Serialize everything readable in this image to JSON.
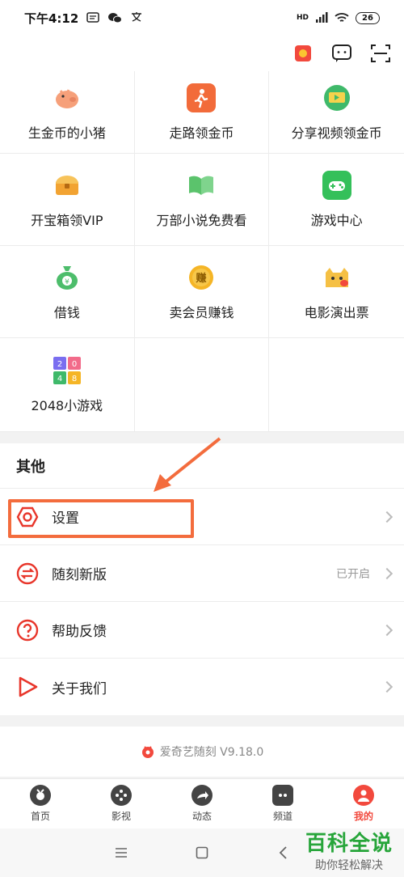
{
  "status_bar": {
    "time": "下午4:12",
    "battery": "26",
    "signal": "HD"
  },
  "grid_items": [
    {
      "label": "生金币的小猪",
      "icon": "pig-icon",
      "color": "#f6a07a"
    },
    {
      "label": "走路领金币",
      "icon": "walking-icon",
      "color": "#f26b3a"
    },
    {
      "label": "分享视频领金币",
      "icon": "share-video-icon",
      "color": "#3fb96a"
    },
    {
      "label": "开宝箱领VIP",
      "icon": "treasure-chest-icon",
      "color": "#f2a332"
    },
    {
      "label": "万部小说免费看",
      "icon": "book-icon",
      "color": "#5bc36c"
    },
    {
      "label": "游戏中心",
      "icon": "game-controller-icon",
      "color": "#34c05a"
    },
    {
      "label": "借钱",
      "icon": "money-bag-icon",
      "color": "#4dbd6b"
    },
    {
      "label": "卖会员赚钱",
      "icon": "earn-coin-icon",
      "color": "#f5b526"
    },
    {
      "label": "电影演出票",
      "icon": "cat-ticket-icon",
      "color": "#f5c044"
    },
    {
      "label": "2048小游戏",
      "icon": "game-2048-icon",
      "color": "#7a6ef0"
    }
  ],
  "other_section": {
    "title": "其他",
    "rows": [
      {
        "label": "设置",
        "icon": "settings-icon",
        "status": ""
      },
      {
        "label": "随刻新版",
        "icon": "switch-icon",
        "status": "已开启"
      },
      {
        "label": "帮助反馈",
        "icon": "help-icon",
        "status": ""
      },
      {
        "label": "关于我们",
        "icon": "play-icon",
        "status": ""
      }
    ]
  },
  "version_text": "爱奇艺随刻 V9.18.0",
  "tabs": [
    {
      "label": "首页",
      "icon": "tv-icon",
      "active": false
    },
    {
      "label": "影视",
      "icon": "film-reel-icon",
      "active": false
    },
    {
      "label": "动态",
      "icon": "share-arrow-icon",
      "active": false
    },
    {
      "label": "频道",
      "icon": "channel-icon",
      "active": false
    },
    {
      "label": "我的",
      "icon": "profile-icon",
      "active": true
    }
  ],
  "watermark": {
    "main": "百科全说",
    "sub": "助你轻松解决"
  },
  "colors": {
    "accent": "#f2493d",
    "highlight": "#f36c3d",
    "watermark": "#27a53a"
  }
}
